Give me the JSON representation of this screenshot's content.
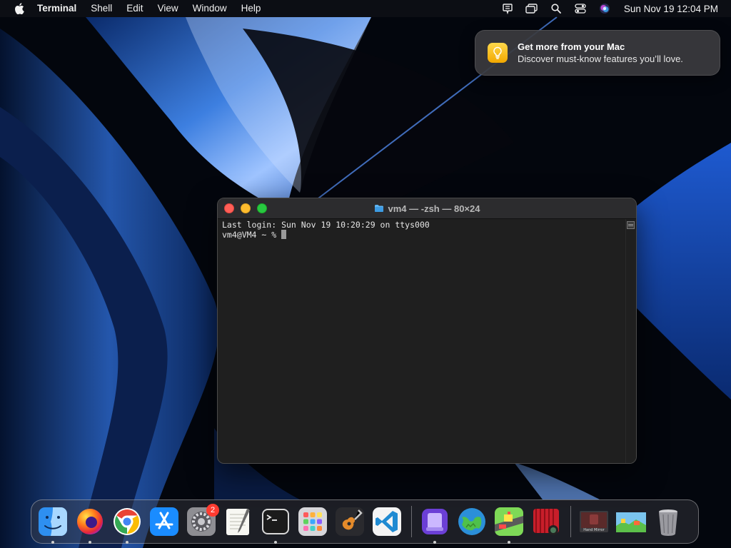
{
  "menubar": {
    "app_name": "Terminal",
    "menus": [
      "Shell",
      "Edit",
      "View",
      "Window",
      "Help"
    ],
    "clock": "Sun Nov 19  12:04 PM",
    "status_icons": [
      "rewind-icon",
      "screen-mirroring-icon",
      "spotlight-search-icon",
      "control-center-icon",
      "siri-icon"
    ]
  },
  "notification": {
    "title": "Get more from your Mac",
    "body": "Discover must-know features you’ll love.",
    "icon": "tips-lightbulb-icon"
  },
  "terminal": {
    "title": "vm4 — -zsh — 80×24",
    "lines": [
      "Last login: Sun Nov 19 10:20:29 on ttys000"
    ],
    "prompt": "vm4@VM4 ~ % "
  },
  "dock": {
    "apps": [
      {
        "name": "finder",
        "running": true
      },
      {
        "name": "firefox",
        "running": true
      },
      {
        "name": "chrome",
        "running": true
      },
      {
        "name": "app-store",
        "running": false
      },
      {
        "name": "system-settings",
        "running": false,
        "badge": "2"
      },
      {
        "name": "textedit",
        "running": false
      },
      {
        "name": "terminal",
        "running": true
      },
      {
        "name": "launchpad",
        "running": false
      },
      {
        "name": "garageband",
        "running": false
      },
      {
        "name": "vscode",
        "running": false
      },
      {
        "name": "simulator",
        "running": true
      },
      {
        "name": "world-app",
        "running": false
      },
      {
        "name": "crossy-road",
        "running": true
      },
      {
        "name": "photo-booth",
        "running": false
      },
      {
        "name": "hand-mirror",
        "running": false,
        "label": "Hand Mirror"
      },
      {
        "name": "game-thumbnail",
        "running": false
      },
      {
        "name": "trash",
        "running": false
      }
    ]
  },
  "colors": {
    "traffic_close": "#ff5f57",
    "traffic_minimize": "#febc2e",
    "traffic_maximize": "#28c840",
    "terminal_bg": "#1f1f1f",
    "badge": "#ff3b30"
  }
}
